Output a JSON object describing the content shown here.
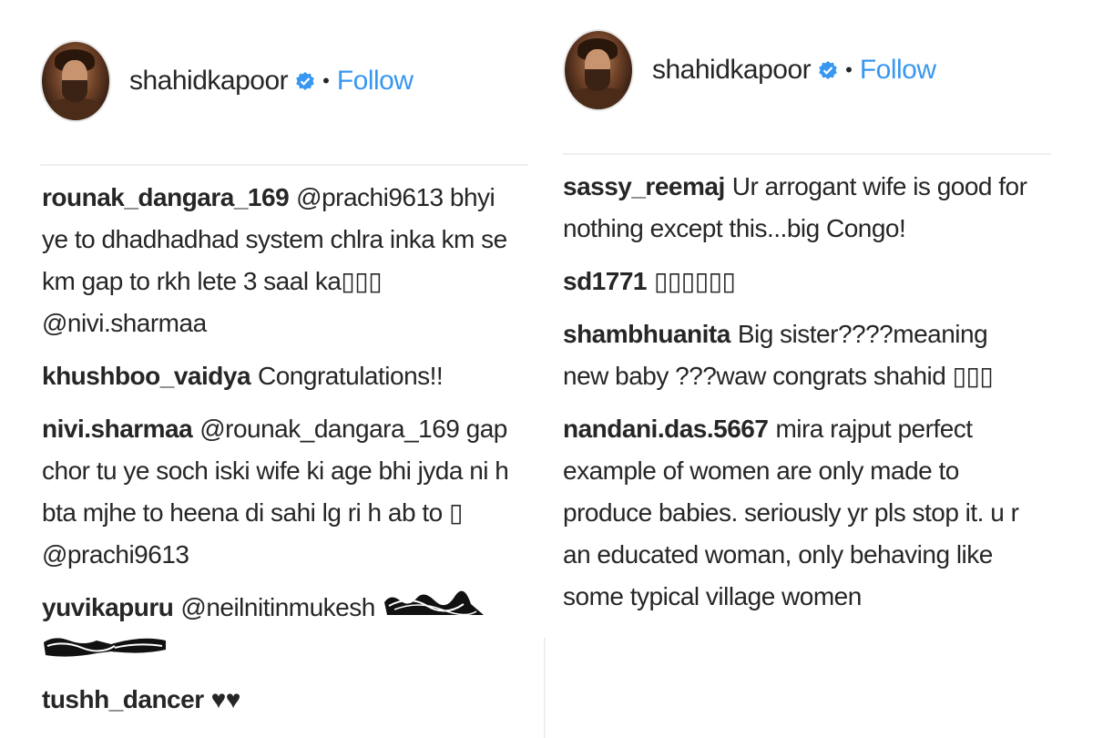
{
  "left": {
    "header": {
      "username": "shahidkapoor",
      "dot": "•",
      "follow": "Follow"
    },
    "comments": [
      {
        "user": "rounak_dangara_169",
        "text": "@prachi9613 bhyi ye to dhadhadhad system chlra inka km se km gap to rkh lete 3 saal ka▯▯▯ @nivi.sharmaa"
      },
      {
        "user": "khushboo_vaidya",
        "text": "Congratulations!!"
      },
      {
        "user": "nivi.sharmaa",
        "text": "@rounak_dangara_169 gap chor tu ye soch iski wife ki age bhi jyda ni h bta mjhe to heena di sahi lg ri h ab to ▯ @prachi9613"
      },
      {
        "user": "yuvikapuru",
        "text": "@neilnitinmukesh"
      },
      {
        "user": "tushh_dancer",
        "text": "♥♥"
      }
    ]
  },
  "right": {
    "header": {
      "username": "shahidkapoor",
      "dot": "•",
      "follow": "Follow"
    },
    "comments": [
      {
        "user": "sassy_reemaj",
        "text": "Ur arrogant wife is good for nothing except this...big Congo!"
      },
      {
        "user": "sd1771",
        "text": "▯▯▯▯▯▯"
      },
      {
        "user": "shambhuanita",
        "text": "Big sister????meaning new baby ???waw congrats shahid ▯▯▯"
      },
      {
        "user": "nandani.das.5667",
        "text": "mira rajput perfect example of women are only made to produce babies. seriously yr pls stop it. u r an educated woman, only behaving like some typical village women"
      }
    ]
  },
  "colors": {
    "link": "#3897f0",
    "text": "#262626",
    "divider": "#efefef"
  },
  "icons": {
    "verified": "verified-badge-icon",
    "avatar": "profile-avatar"
  }
}
